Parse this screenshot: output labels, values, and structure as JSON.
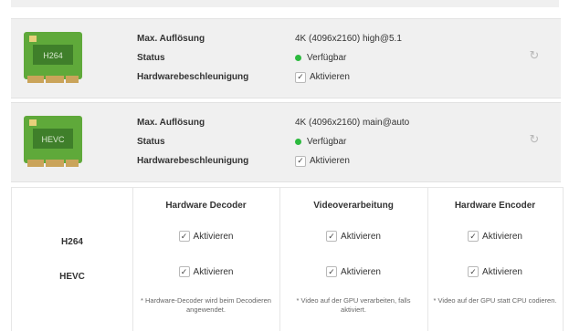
{
  "codecs": [
    {
      "chip_label": "H264",
      "max_res_label": "Max. Auflösung",
      "max_res_value": "4K (4096x2160) high@5.1",
      "status_label": "Status",
      "status_value": "Verfügbar",
      "hw_label": "Hardwarebeschleunigung",
      "hw_value": "Aktivieren",
      "status_color": "#2cba3e"
    },
    {
      "chip_label": "HEVC",
      "max_res_label": "Max. Auflösung",
      "max_res_value": "4K (4096x2160) main@auto",
      "status_label": "Status",
      "status_value": "Verfügbar",
      "hw_label": "Hardwarebeschleunigung",
      "hw_value": "Aktivieren",
      "status_color": "#2cba3e"
    }
  ],
  "matrix": {
    "headers": [
      "Hardware Decoder",
      "Videoverarbeitung",
      "Hardware Encoder"
    ],
    "rows": [
      "H264",
      "HEVC"
    ],
    "checkbox_label": "Aktivieren",
    "notes": [
      "* Hardware-Decoder wird beim Decodieren angewendet.",
      "* Video auf der GPU verarbeiten, falls aktiviert.",
      "* Video auf der GPU statt CPU codieren."
    ]
  },
  "icons": {
    "refresh": "refresh-icon",
    "check": "checkmark-icon",
    "chip": "gpu-chip-icon"
  }
}
